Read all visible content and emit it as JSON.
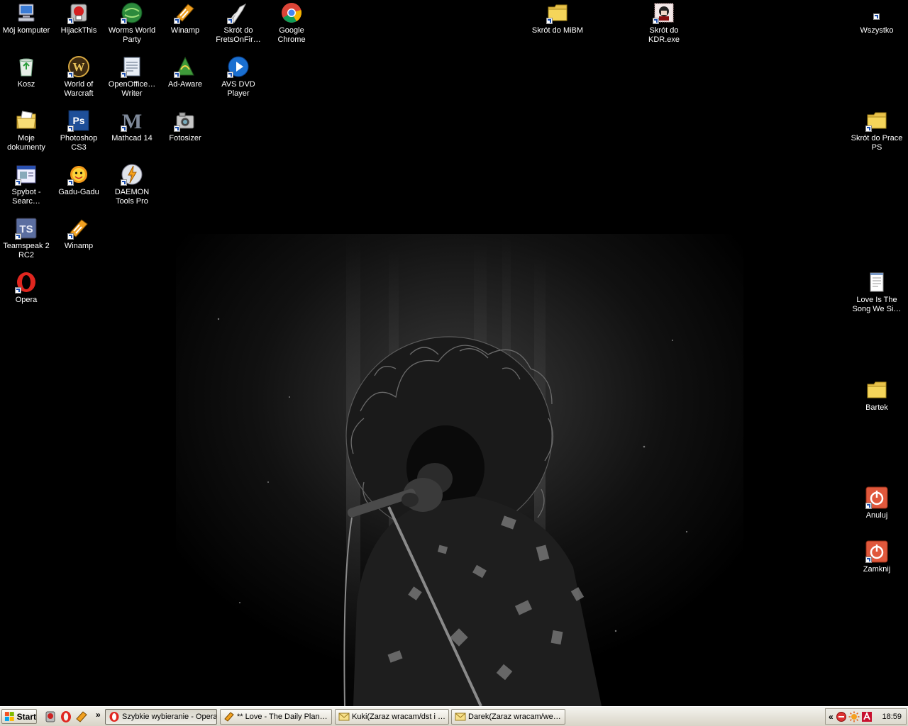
{
  "desktop": {
    "icons": [
      {
        "label": "Mój komputer",
        "icon": "my-computer-icon"
      },
      {
        "label": "HijackThis",
        "icon": "hijackthis-icon"
      },
      {
        "label": "Worms World Party",
        "icon": "worms-icon"
      },
      {
        "label": "Winamp",
        "icon": "winamp-icon"
      },
      {
        "label": "Skrót do FretsOnFir…",
        "icon": "frets-icon"
      },
      {
        "label": "Google Chrome",
        "icon": "chrome-icon"
      },
      {
        "label": "Skrót do MiBM",
        "icon": "folder-icon"
      },
      {
        "label": "Skrót do KDR.exe",
        "icon": "kdr-icon"
      },
      {
        "label": "Wszystko",
        "icon": "shortcut-icon"
      },
      {
        "label": "Kosz",
        "icon": "recycle-bin-icon"
      },
      {
        "label": "World of Warcraft",
        "icon": "wow-icon"
      },
      {
        "label": "OpenOffice… Writer",
        "icon": "writer-icon"
      },
      {
        "label": "Ad-Aware",
        "icon": "adaware-icon"
      },
      {
        "label": "AVS DVD Player",
        "icon": "dvd-player-icon"
      },
      {
        "label": "Moje dokumenty",
        "icon": "my-documents-icon"
      },
      {
        "label": "Photoshop CS3",
        "icon": "photoshop-icon"
      },
      {
        "label": "Mathcad 14",
        "icon": "mathcad-icon"
      },
      {
        "label": "Fotosizer",
        "icon": "fotosizer-icon"
      },
      {
        "label": "Skrót do Prace PS",
        "icon": "folder-icon"
      },
      {
        "label": "Spybot - Searc…",
        "icon": "spybot-icon"
      },
      {
        "label": "Gadu-Gadu",
        "icon": "gadu-gadu-icon"
      },
      {
        "label": "DAEMON Tools Pro",
        "icon": "daemon-tools-icon"
      },
      {
        "label": "Teamspeak 2 RC2",
        "icon": "teamspeak-icon"
      },
      {
        "label": "Winamp",
        "icon": "winamp-icon"
      },
      {
        "label": "Opera",
        "icon": "opera-icon"
      },
      {
        "label": "Love Is The Song We Si…",
        "icon": "text-document-icon"
      },
      {
        "label": "Bartek",
        "icon": "folder-icon"
      },
      {
        "label": "Anuluj",
        "icon": "power-icon"
      },
      {
        "label": "Zamknij",
        "icon": "power-icon"
      }
    ]
  },
  "taskbar": {
    "start_label": "Start",
    "quick_launch": [
      "hijackthis-icon",
      "opera-icon",
      "winamp-icon"
    ],
    "chevron": "»",
    "tasks": [
      {
        "label": "Szybkie wybieranie - Opera",
        "icon": "opera-icon"
      },
      {
        "label": "** Love - The Daily Plan…",
        "icon": "winamp-icon"
      },
      {
        "label": "Kuki(Zaraz wracam/dst i …",
        "icon": "mail-envelope-icon"
      },
      {
        "label": "Darek(Zaraz wracam/we…",
        "icon": "mail-envelope-icon"
      }
    ],
    "tray": {
      "chevron": "«",
      "icons": [
        "red-shield-icon",
        "sun-icon",
        "antivirus-icon"
      ],
      "clock": "18:59"
    }
  },
  "colors": {
    "desktop_bg": "#000000",
    "taskbar_bg": "#e9e7de",
    "folder": "#f5d55a",
    "power_red": "#e0583c"
  }
}
